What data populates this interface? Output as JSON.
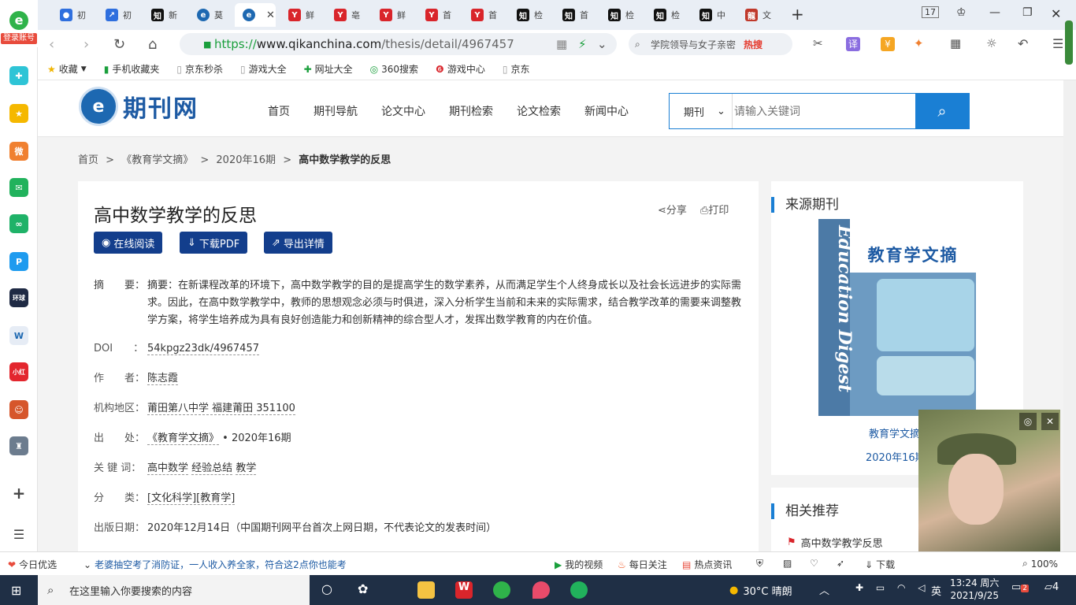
{
  "tabs": [
    {
      "icon": "paw-icon",
      "label": "初",
      "color": "#2f6fde"
    },
    {
      "icon": "trend-icon",
      "label": "初",
      "color": "#2f6fde"
    },
    {
      "icon": "zhi-icon",
      "label": "新",
      "color": "#111111"
    },
    {
      "icon": "e-icon",
      "label": "莫",
      "color": "#1d68b1"
    },
    {
      "icon": "e-icon",
      "label": "",
      "color": "#1d68b1"
    },
    {
      "icon": "y-icon",
      "label": "鲜",
      "color": "#d9252b"
    },
    {
      "icon": "y-icon",
      "label": "亳",
      "color": "#d9252b"
    },
    {
      "icon": "y-icon",
      "label": "鲜",
      "color": "#d9252b"
    },
    {
      "icon": "y-icon",
      "label": "首",
      "color": "#d9252b"
    },
    {
      "icon": "y-icon",
      "label": "首",
      "color": "#d9252b"
    },
    {
      "icon": "zhi-icon",
      "label": "检",
      "color": "#111111"
    },
    {
      "icon": "zhi-icon",
      "label": "首",
      "color": "#111111"
    },
    {
      "icon": "zhi-icon",
      "label": "检",
      "color": "#111111"
    },
    {
      "icon": "zhi-icon",
      "label": "检",
      "color": "#111111"
    },
    {
      "icon": "zhi-icon",
      "label": "中",
      "color": "#111111"
    },
    {
      "icon": "long-icon",
      "label": "文",
      "color": "#c0392b"
    }
  ],
  "tab_counter": "17",
  "login_label": "登录账号",
  "address": {
    "scheme": "https://",
    "host": "www.qikanchina.com",
    "path": "/thesis/detail/4967457"
  },
  "browser_search": {
    "text": "学院领导与女子亲密",
    "hot": "热搜"
  },
  "bookmarks": [
    "收藏",
    "手机收藏夹",
    "京东秒杀",
    "游戏大全",
    "网址大全",
    "360搜索",
    "游戏中心",
    "京东"
  ],
  "site": {
    "logo_text": "期刊网",
    "nav": [
      "首页",
      "期刊导航",
      "论文中心",
      "期刊检索",
      "论文检索",
      "新闻中心"
    ],
    "search_type": "期刊",
    "search_placeholder": "请输入关键词"
  },
  "breadcrumb": {
    "home": "首页",
    "journal": "《教育学文摘》",
    "issue": "2020年16期",
    "current": "高中数学教学的反思",
    "sep": ">"
  },
  "article": {
    "title": "高中数学教学的反思",
    "share": "分享",
    "print": "打印",
    "btn_read": "在线阅读",
    "btn_pdf": "下载PDF",
    "btn_export": "导出详情",
    "abstract_label": "摘　　要：",
    "abstract": "摘要：在新课程改革的环境下，高中数学教学的目的是提高学生的数学素养，从而满足学生个人终身成长以及社会长远进步的实际需求。因此，在高中数学教学中，教师的思想观念必须与时俱进，深入分析学生当前和未来的实际需求，结合教学改革的需要来调整教学方案，将学生培养成为具有良好创造能力和创新精神的综合型人才，发挥出数学教育的内在价值。",
    "doi_label": "DOI　　：",
    "doi": "54kpgz23dk/4967457",
    "author_label": "作　　者：",
    "author": "陈志霞",
    "org_label": "机构地区：",
    "org": "莆田第八中学 福建莆田 351100",
    "source_label": "出　　处：",
    "source_journal": "《教育学文摘》",
    "source_issue": " • 2020年16期",
    "kw_label": "关  键  词：",
    "keywords": [
      "高中数学",
      "经验总结",
      "教学"
    ],
    "cls_label": "分　　类：",
    "cls": "[文化科学][教育学]",
    "date_label": "出版日期：",
    "date": "2020年12月14日（中国期刊网平台首次上网日期，不代表论文的发表时间）"
  },
  "sidebar_right": {
    "source_title": "来源期刊",
    "cover_en": "Education Digest",
    "cover_cn": "教育学文摘",
    "cover_caption": "教育学文摘",
    "cover_issue": "2020年16期",
    "related_title": "相关推荐",
    "related_item": "高中数学教学反思"
  },
  "statusbar": {
    "left": "今日优选",
    "ticker": "老婆抽空考了消防证，一人收入养全家，符合这2点你也能考",
    "items": [
      "我的视频",
      "每日关注",
      "热点资讯",
      "下载"
    ],
    "zoom": "100%"
  },
  "taskbar": {
    "search_placeholder": "在这里输入你要搜索的内容",
    "weather": "30°C 晴朗",
    "ime": "英",
    "time": "13:24 周六",
    "date": "2021/9/25",
    "notif": "4",
    "badge": "2"
  },
  "colors": {
    "brand": "#1a7fd4",
    "button": "#133e8c",
    "link": "#1d5aa3"
  }
}
